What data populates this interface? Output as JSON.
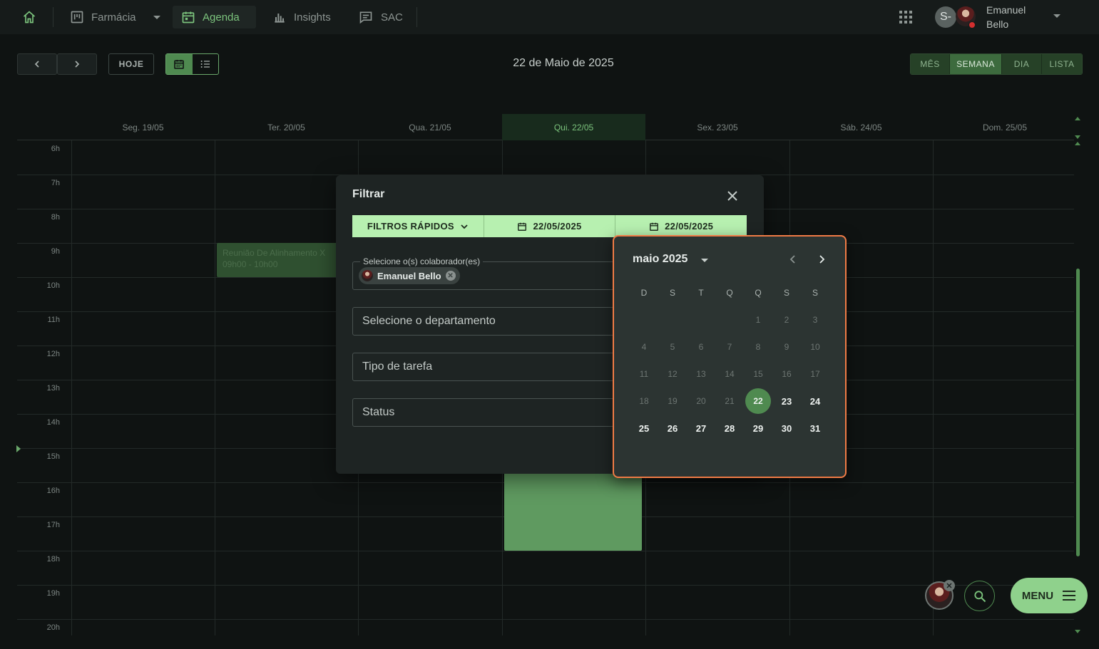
{
  "nav": {
    "home_icon": "home-icon",
    "items": [
      {
        "label": "Farmácia",
        "icon": "kanban-icon",
        "active": false
      },
      {
        "label": "Agenda",
        "icon": "calendar-icon",
        "active": true
      },
      {
        "label": "Insights",
        "icon": "bar-chart-icon",
        "active": false
      },
      {
        "label": "SAC",
        "icon": "chat-icon",
        "active": false
      }
    ],
    "user": {
      "initial": "S-",
      "first": "Emanuel",
      "last": "Bello"
    }
  },
  "toolbar": {
    "today_label": "HOJE",
    "current_date": "22 de Maio de 2025",
    "modes": [
      "MÊS",
      "SEMANA",
      "DIA",
      "LISTA"
    ],
    "selected_mode": "SEMANA"
  },
  "calendar": {
    "days": [
      "Seg. 19/05",
      "Ter. 20/05",
      "Qua. 21/05",
      "Qui. 22/05",
      "Sex. 23/05",
      "Sáb. 24/05",
      "Dom. 25/05"
    ],
    "today": "Qui. 22/05",
    "hours": [
      "6h",
      "7h",
      "8h",
      "9h",
      "10h",
      "11h",
      "12h",
      "13h",
      "14h",
      "15h",
      "16h",
      "17h",
      "18h",
      "19h",
      "20h"
    ],
    "events": [
      {
        "title": "Reunião De Alinhamento X",
        "time": "09h00 - 10h00"
      }
    ]
  },
  "modal": {
    "title": "Filtrar",
    "quick_filters_label": "FILTROS RÁPIDOS",
    "date_start": "22/05/2025",
    "date_end": "22/05/2025",
    "collaborators_legend": "Selecione o(s) colaborador(es)",
    "collaborator_chip": "Emanuel Bello",
    "department_label": "Selecione o departamento",
    "task_type_label": "Tipo de tarefa",
    "status_label": "Status"
  },
  "datepicker": {
    "month_label": "maio 2025",
    "weekdays": [
      "D",
      "S",
      "T",
      "Q",
      "Q",
      "S",
      "S"
    ],
    "weeks": [
      [
        "",
        "",
        "",
        "",
        "1",
        "2",
        "3"
      ],
      [
        "4",
        "5",
        "6",
        "7",
        "8",
        "9",
        "10"
      ],
      [
        "11",
        "12",
        "13",
        "14",
        "15",
        "16",
        "17"
      ],
      [
        "18",
        "19",
        "20",
        "21",
        "22",
        "23",
        "24"
      ],
      [
        "25",
        "26",
        "27",
        "28",
        "29",
        "30",
        "31"
      ]
    ],
    "selected": "22",
    "enabled_from": 22
  },
  "fab": {
    "menu_label": "MENU"
  },
  "colors": {
    "accent": "#4f8a50",
    "accent_light": "#b7f0b0",
    "picker_border": "#f07b45"
  }
}
